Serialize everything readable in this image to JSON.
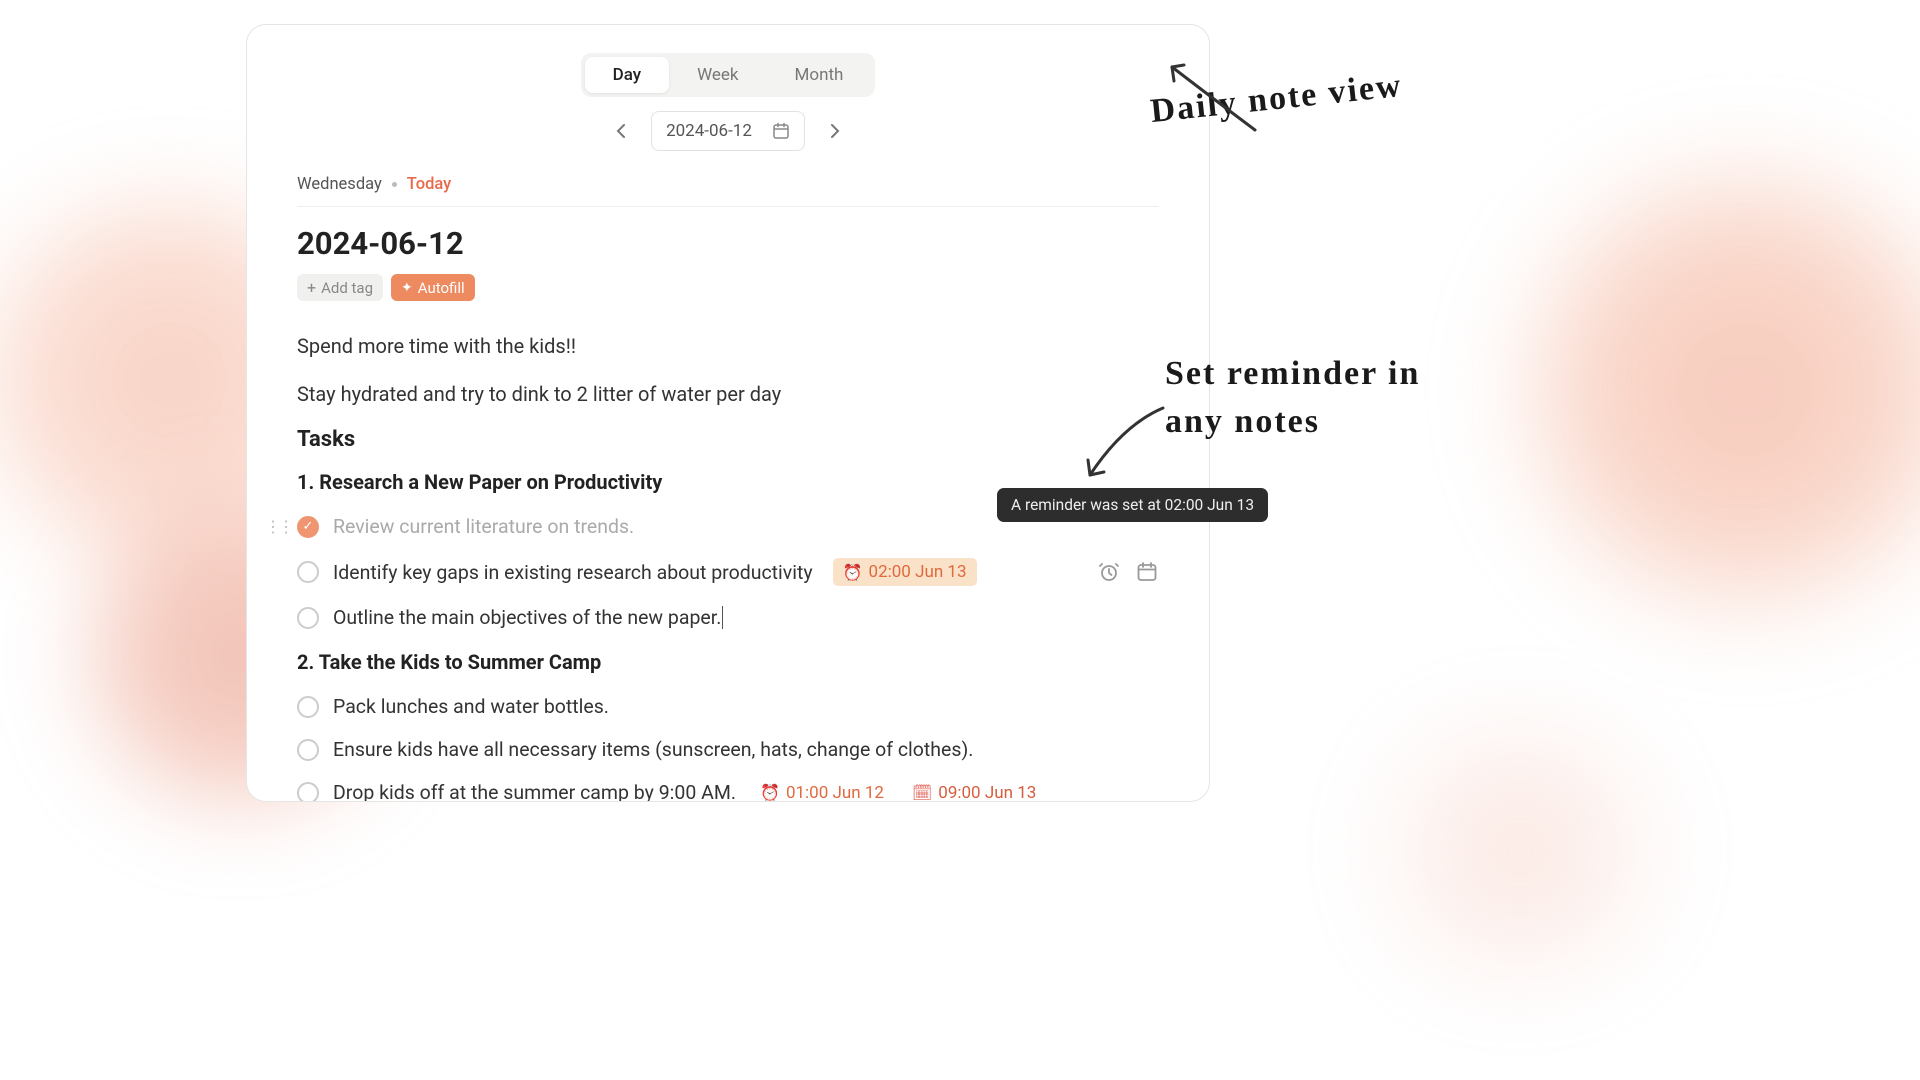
{
  "viewTabs": {
    "day": "Day",
    "week": "Week",
    "month": "Month",
    "active": "day"
  },
  "dateNav": {
    "date": "2024-06-12"
  },
  "dayLine": {
    "weekday": "Wednesday",
    "today": "Today"
  },
  "note": {
    "title": "2024-06-12",
    "addTag": "Add tag",
    "autofill": "Autofill",
    "line1": "Spend more time with the kids!!",
    "line2": "Stay hydrated and try to dink to 2 litter of water per day"
  },
  "tasksHeading": "Tasks",
  "sections": [
    {
      "heading": "1. Research a New Paper on Productivity",
      "items": [
        {
          "text": "Review current literature on trends.",
          "done": true,
          "drag": true
        },
        {
          "text": "Identify key gaps in existing research about productivity",
          "done": false,
          "reminder": {
            "icon": "⏰",
            "label": "02:00 Jun 13",
            "highlighted": true
          },
          "actions": true
        },
        {
          "text": "Outline the main objectives of the new paper",
          "done": false,
          "caret": true
        }
      ]
    },
    {
      "heading": "2. Take the Kids to Summer Camp",
      "items": [
        {
          "text": "Pack lunches and water bottles.",
          "done": false
        },
        {
          "text": "Ensure kids have all necessary items (sunscreen, hats, change of clothes).",
          "done": false
        },
        {
          "text": "Drop kids off at the summer camp by 9:00 AM.",
          "done": false,
          "reminder": {
            "icon": "⏰",
            "label": "01:00 Jun 12",
            "highlighted": false
          },
          "calendar": {
            "icon": "🗓",
            "label": "09:00 Jun 13"
          }
        }
      ]
    }
  ],
  "tooltip": "A reminder was set at 02:00 Jun 13",
  "annotations": {
    "a1": "Daily note view",
    "a2_l1": "Set reminder in",
    "a2_l2": "any notes"
  }
}
